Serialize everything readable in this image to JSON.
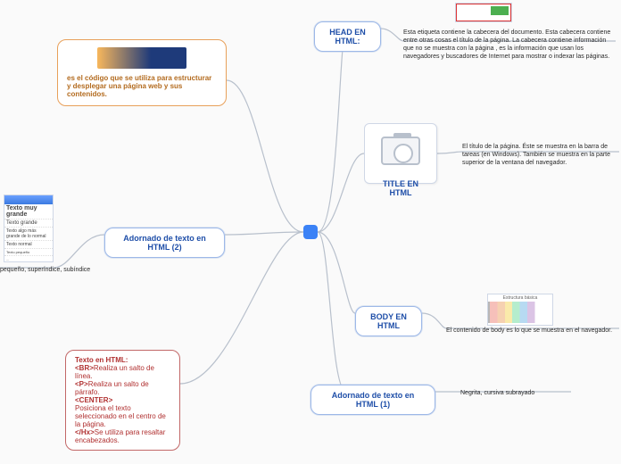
{
  "center": {
    "style": "left:340px;top:252px"
  },
  "nodes": {
    "head": {
      "label": "HEAD EN HTML:",
      "style": "left:352px;top:24px;width:75px"
    },
    "title": {
      "label": "TITLE EN HTML",
      "style_box": "left:408px;top:138px;width:82px;height:68px"
    },
    "adorn2": {
      "label": "Adornado de texto en HTML (2)",
      "style": "left:117px;top:255px;width:135px"
    },
    "body": {
      "label": "BODY EN HTML",
      "style": "left:398px;top:343px;width:75px"
    },
    "adorn1": {
      "label": "Adornado de texto en HTML (1)",
      "style": "left:348px;top:431px;width:140px"
    }
  },
  "orange": {
    "style": "left:64px;top:44px;width:190px",
    "text": "es el código que se utiliza para estructurar y desplegar una página web y sus contenidos."
  },
  "details": {
    "head": {
      "style": "left:452px;top:32px;width:240px",
      "text": "Esta etiqueta contiene la cabecera del documento. Esta cabecera contiene entre otras cosas el título de la página. La cabecera contiene información que no se muestra con la página , es la información que usan los navegadores y buscadores de Internet para mostrar o indexar las páginas."
    },
    "title": {
      "style": "left:518px;top:160px;width:176px",
      "text": "El título de la página. Éste se muestra en la barra de tareas (en Windows). También se muestra en la parte superior de la ventana del navegador."
    },
    "body": {
      "style": "left:500px;top:366px;width:196px",
      "text": "El contenido de body es lo que se muestra en el navegador."
    },
    "adorn1": {
      "style": "left:516px;top:436px;width:128px",
      "text": "Negrita, cursiva  subrayado"
    },
    "adorn2": {
      "style": "left:0px;top:298px;width:110px",
      "text": "pequeño, superíndice, subíndice"
    }
  },
  "redbox": {
    "style": "left:73px;top:392px;width:129px",
    "lines": {
      "a_k": "Texto en HTML: <BR>",
      "a_t": "Realiza un salto de línea.",
      "b_k": "<P>",
      "b_t": "Realiza un salto de párrafo.",
      "c_k": "<CENTER>",
      "c_t": "Posiciona el texto seleccionado en el centro de la página.",
      "d_k": "</Hx>",
      "d_t": "Se utiliza para resaltar encabezados."
    }
  },
  "thumbs": {
    "head_red": {
      "style": "left:510px;top:3px;width:64px"
    },
    "body_color": {
      "style": "left:546px;top:329px;width:74px;height:36px",
      "caption": "Estructura básica"
    },
    "browser": {
      "style": "left:4px;top:218px;width:56px;height:76px",
      "l1": "Texto muy grande",
      "l2": "Texto grande",
      "l3": "Texto algo más grande de lo normal",
      "l4": "Texto normal",
      "l5": "Texto pequeño",
      "l6": "..."
    }
  }
}
